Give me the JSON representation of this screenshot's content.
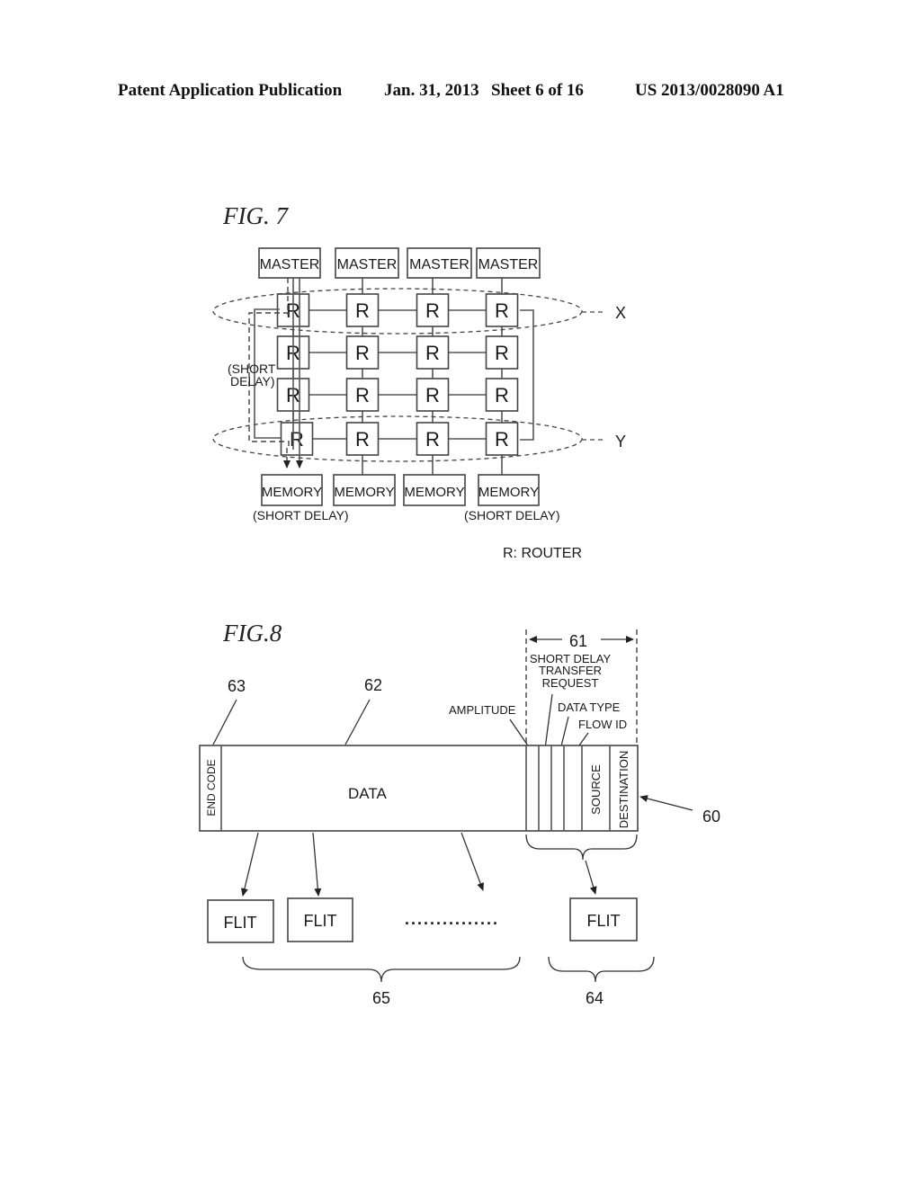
{
  "header": {
    "publication": "Patent Application Publication",
    "date": "Jan. 31, 2013",
    "sheet": "Sheet 6 of 16",
    "number": "US 2013/0028090 A1"
  },
  "fig7": {
    "title": "FIG. 7",
    "masters": [
      "MASTER",
      "MASTER",
      "MASTER",
      "MASTER"
    ],
    "router_label": "R",
    "router_grid": {
      "rows": 4,
      "cols": 4
    },
    "memories": [
      "MEMORY",
      "MEMORY",
      "MEMORY",
      "MEMORY"
    ],
    "short_delay_side": "(SHORT DELAY)",
    "short_delay_side_lines": [
      "(SHORT",
      "DELAY)"
    ],
    "short_delay_mem_left": "(SHORT DELAY)",
    "short_delay_mem_right": "(SHORT DELAY)",
    "group_x": "X",
    "group_y": "Y",
    "legend": "R:  ROUTER"
  },
  "fig8": {
    "title": "FIG.8",
    "ref_63": "63",
    "ref_62": "62",
    "ref_61": "61",
    "ref_60": "60",
    "ref_65": "65",
    "ref_64": "64",
    "end_code": "END CODE",
    "data": "DATA",
    "amplitude": "AMPLITUDE",
    "short_delay_request_lines": [
      "SHORT DELAY",
      "TRANSFER",
      "REQUEST"
    ],
    "data_type": "DATA TYPE",
    "flow_id": "FLOW ID",
    "source": "SOURCE",
    "destination": "DESTINATION",
    "flits": [
      "FLIT",
      "FLIT",
      "FLIT"
    ],
    "ellipsis": "..............."
  }
}
